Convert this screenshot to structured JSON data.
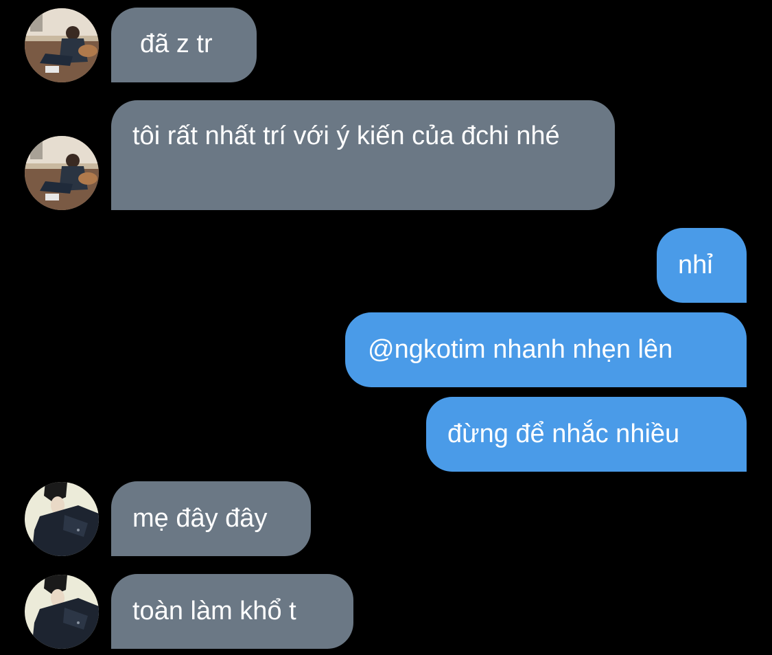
{
  "colors": {
    "background": "#000000",
    "incoming_bubble": "#6b7885",
    "outgoing_bubble": "#4a9be8",
    "text": "#ffffff"
  },
  "messages": [
    {
      "direction": "incoming",
      "text": "đã z tr"
    },
    {
      "direction": "incoming",
      "text": "tôi rất nhất trí với ý kiến của đchi nhé"
    },
    {
      "direction": "outgoing",
      "text": "nhỉ"
    },
    {
      "direction": "outgoing",
      "text": "@ngkotim nhanh nhẹn lên"
    },
    {
      "direction": "outgoing",
      "text": "đừng để nhắc nhiều"
    },
    {
      "direction": "incoming",
      "text": "mẹ đây đây"
    },
    {
      "direction": "incoming",
      "text": "toàn làm khổ t"
    }
  ]
}
